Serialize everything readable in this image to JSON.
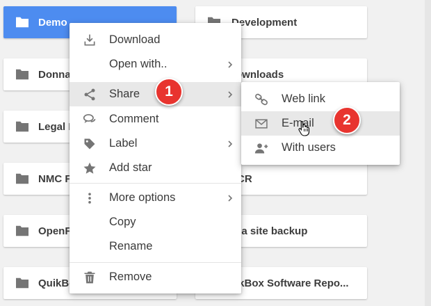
{
  "folders": [
    {
      "label": "Demo",
      "selected": true
    },
    {
      "label": "Development"
    },
    {
      "label": "Donna"
    },
    {
      "label": "ownloads"
    },
    {
      "label": "Legal I"
    },
    {
      "label": "NMC F"
    },
    {
      "label": "CR"
    },
    {
      "label": "OpenF"
    },
    {
      "label": "sa site backup"
    },
    {
      "label": "QuikBo"
    },
    {
      "label": "ikBox Software Repo..."
    }
  ],
  "context_menu": {
    "items": [
      {
        "label": "Download",
        "icon": "download-icon"
      },
      {
        "label": "Open with..",
        "icon": "none",
        "has_submenu": true
      },
      {
        "label": "Share",
        "icon": "share-icon",
        "has_submenu": true,
        "highlighted": true
      },
      {
        "label": "Comment",
        "icon": "comment-icon"
      },
      {
        "label": "Label",
        "icon": "label-icon",
        "has_submenu": true
      },
      {
        "label": "Add star",
        "icon": "star-icon"
      },
      {
        "label": "More options",
        "icon": "more-vert-icon",
        "has_submenu": true
      },
      {
        "label": "Copy",
        "icon": "none"
      },
      {
        "label": "Rename",
        "icon": "none"
      },
      {
        "label": "Remove",
        "icon": "trash-icon"
      }
    ]
  },
  "share_submenu": {
    "items": [
      {
        "label": "Web link",
        "icon": "link-icon"
      },
      {
        "label": "E-mail",
        "icon": "mail-icon",
        "highlighted": true
      },
      {
        "label": "With users",
        "icon": "add-user-icon"
      }
    ]
  },
  "badges": [
    "1",
    "2"
  ],
  "colors": {
    "selected": "#4d8cf0",
    "badge": "#e8342f",
    "icon": "#757575"
  }
}
